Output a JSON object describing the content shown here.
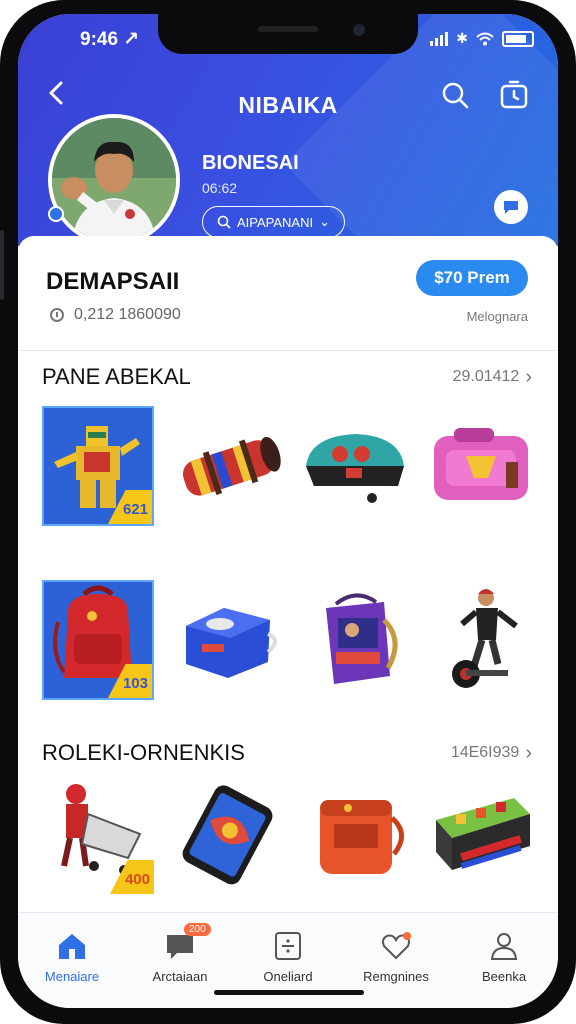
{
  "status_bar": {
    "time": "9:46 ↗"
  },
  "header": {
    "title": "NIBAIKA",
    "profile_name": "BIONESAI",
    "profile_sub": "06:62",
    "pill_label": "AIPAPANANI"
  },
  "info": {
    "title": "DEMAPSAII",
    "meta": "0,212 1860090",
    "price_button": "$70 Prem",
    "right_label": "Melognara"
  },
  "sections": [
    {
      "title": "PANE ABEKAL",
      "more": "29.01412"
    },
    {
      "title": "ROLEKI-ORNENKIS",
      "more": "14E6I939"
    }
  ],
  "badges": {
    "item1": "621",
    "item5": "103",
    "item9": "400"
  },
  "nav": {
    "badge": "200",
    "items": [
      "Menaiare",
      "Arctaiaan",
      "Oneliard",
      "Remgnines",
      "Beenka"
    ]
  },
  "colors": {
    "accent": "#2f6fe8",
    "header_start": "#3a3fd6",
    "header_end": "#1f6de0",
    "badge": "#f5c518"
  }
}
